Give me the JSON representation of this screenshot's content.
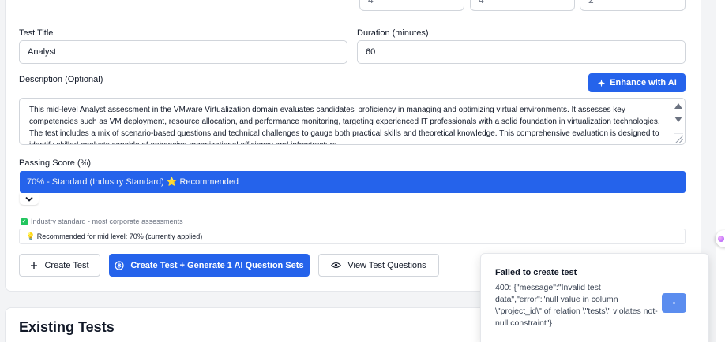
{
  "top_inputs": [
    "4",
    "4",
    "2"
  ],
  "test_title": {
    "label": "Test Title",
    "value": "Analyst"
  },
  "duration": {
    "label": "Duration (minutes)",
    "value": "60"
  },
  "description": {
    "label": "Description (Optional)",
    "enhance_label": "Enhance with AI",
    "value": "This mid-level Analyst assessment in the VMware Virtualization domain evaluates candidates' proficiency in managing and optimizing virtual environments. It assesses key competencies such as VM deployment, resource allocation, and performance monitoring, targeting experienced IT professionals with a solid foundation in virtualization technologies. The test includes a mix of scenario-based questions and technical challenges to gauge both practical skills and theoretical knowledge. This comprehensive evaluation is designed to identify skilled analysts capable of enhancing organizational efficiency and infrastructure"
  },
  "passing_score": {
    "label": "Passing Score (%)",
    "selected": "70% - Standard (Industry Standard) ⭐ Recommended",
    "hint": "Industry standard - most corporate assessments",
    "recommendation": "💡 Recommended for mid level: 70% (currently applied)"
  },
  "actions": {
    "create_test": "Create Test",
    "create_generate": "Create Test + Generate 1 AI Question Sets",
    "view_questions": "View Test Questions"
  },
  "existing_tests_heading": "Existing Tests",
  "toast": {
    "title": "Failed to create test",
    "message": "400: {\"message\":\"Invalid test data\",\"error\":\"null value in column \\\"project_id\\\" of relation \\\"tests\\\" violates not-null constraint\"}"
  },
  "colors": {
    "primary": "#2563eb",
    "success": "#22c55e"
  }
}
